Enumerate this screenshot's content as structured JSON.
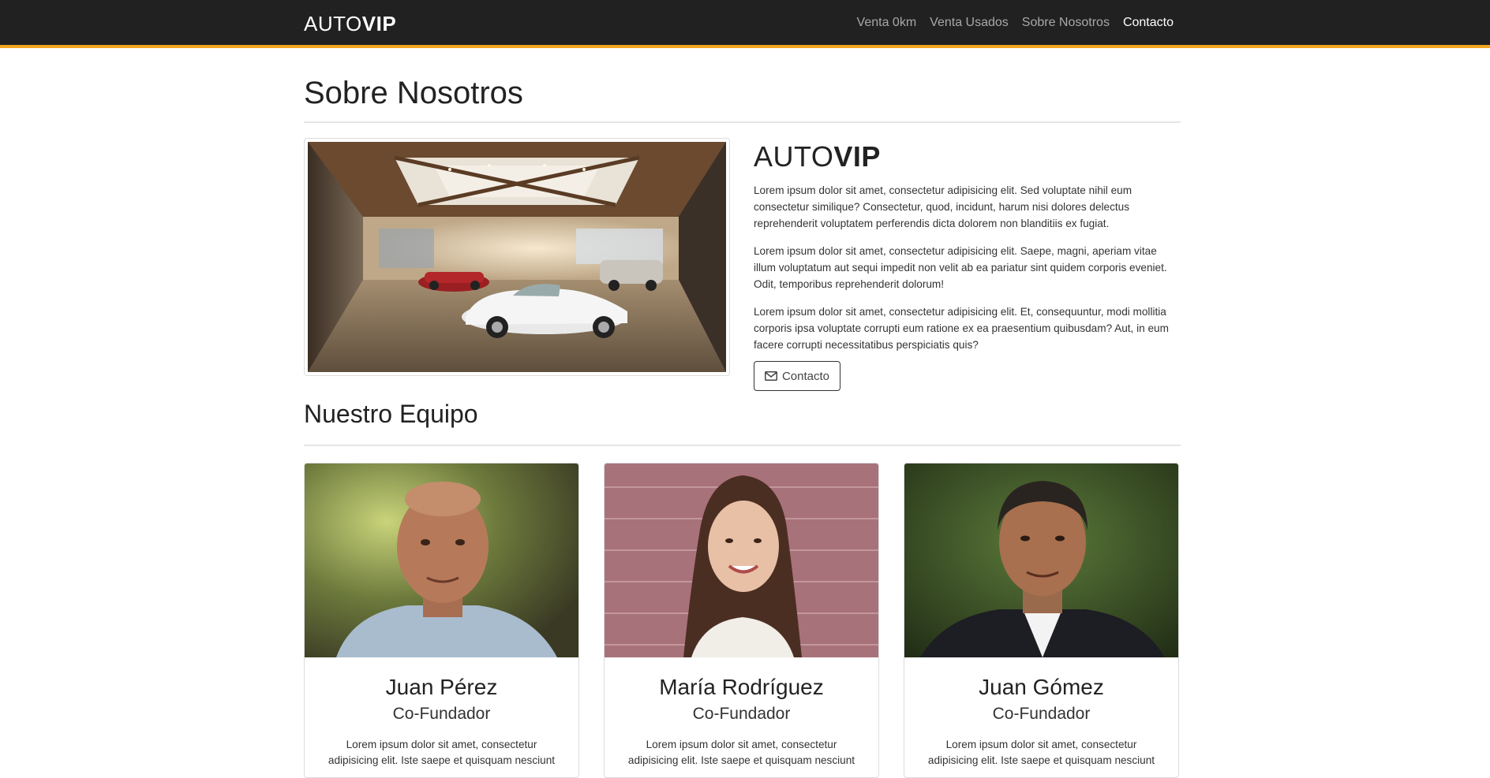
{
  "navbar": {
    "brand_light": "AUTO",
    "brand_bold": "VIP",
    "links": [
      {
        "label": "Venta 0km"
      },
      {
        "label": "Venta Usados"
      },
      {
        "label": "Sobre Nosotros"
      },
      {
        "label": "Contacto"
      }
    ],
    "accent_color": "#f2a51e",
    "background_color": "#212121"
  },
  "page": {
    "title": "Sobre Nosotros"
  },
  "about": {
    "brand_light": "AUTO",
    "brand_bold": "VIP",
    "paragraphs": [
      "Lorem ipsum dolor sit amet, consectetur adipisicing elit. Sed voluptate nihil eum consectetur similique? Consectetur, quod, incidunt, harum nisi dolores delectus reprehenderit voluptatem perferendis dicta dolorem non blanditiis ex fugiat.",
      "Lorem ipsum dolor sit amet, consectetur adipisicing elit. Saepe, magni, aperiam vitae illum voluptatum aut sequi impedit non velit ab ea pariatur sint quidem corporis eveniet. Odit, temporibus reprehenderit dolorum!",
      "Lorem ipsum dolor sit amet, consectetur adipisicing elit. Et, consequuntur, modi mollitia corporis ipsa voluptate corrupti eum ratione ex ea praesentium quibusdam? Aut, in eum facere corrupti necessitatibus perspiciatis quis?"
    ],
    "button_label": "Contacto",
    "button_icon": "envelope-icon"
  },
  "team": {
    "title": "Nuestro Equipo",
    "members": [
      {
        "name": "Juan Pérez",
        "role": "Co-Fundador",
        "text": "Lorem ipsum dolor sit amet, consectetur adipisicing elit. Iste saepe et quisquam nesciunt"
      },
      {
        "name": "María Rodríguez",
        "role": "Co-Fundador",
        "text": "Lorem ipsum dolor sit amet, consectetur adipisicing elit. Iste saepe et quisquam nesciunt"
      },
      {
        "name": "Juan Gómez",
        "role": "Co-Fundador",
        "text": "Lorem ipsum dolor sit amet, consectetur adipisicing elit. Iste saepe et quisquam nesciunt"
      }
    ]
  }
}
